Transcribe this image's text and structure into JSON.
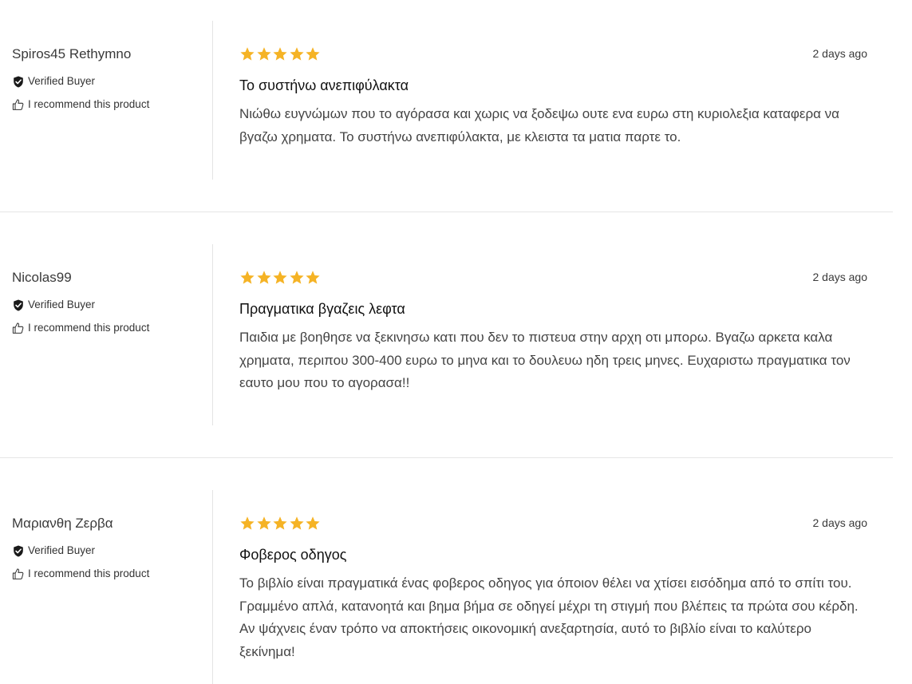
{
  "labels": {
    "verified": "Verified Buyer",
    "recommend": "I recommend this product"
  },
  "colors": {
    "star": "#F5B325",
    "divider": "#e5e5e5"
  },
  "reviews": [
    {
      "author": "Spiros45 Rethymno",
      "rating": 5,
      "date": "2 days ago",
      "title": "Το συστήνω ανεπιφύλακτα",
      "body": "Νιώθω ευγνώμων που το αγόρασα και χωρις να ξοδεψω ουτε ενα ευρω στη κυριολεξια καταφερα να βγαζω χρηματα. Το συστήνω ανεπιφύλακτα, με κλειστα τα ματια παρτε το."
    },
    {
      "author": "Nicolas99",
      "rating": 5,
      "date": "2 days ago",
      "title": "Πραγματικα βγαζεις λεφτα",
      "body": "Παιδια με βοηθησε να ξεκινησω κατι που δεν το πιστευα στην αρχη οτι μπορω. Βγαζω αρκετα καλα χρηματα, περιπου 300-400 ευρω το μηνα και το δουλευω ηδη τρεις μηνες. Ευχαριστω πραγματικα τον εαυτο μου που το αγορασα!!"
    },
    {
      "author": "Μαριανθη Ζερβα",
      "rating": 5,
      "date": "2 days ago",
      "title": "Φοβερος οδηγος",
      "body": "Το βιβλίο είναι πραγματικά ένας φοβερος οδηγος για όποιον θέλει να χτίσει εισόδημα από το σπίτι του. Γραμμένο απλά, κατανοητά και βημα βήμα σε οδηγεί μέχρι τη στιγμή που βλέπεις τα πρώτα σου κέρδη. Αν ψάχνεις έναν τρόπο να αποκτήσεις οικονομική ανεξαρτησία, αυτό το βιβλίο είναι το καλύτερο ξεκίνημα!"
    }
  ]
}
